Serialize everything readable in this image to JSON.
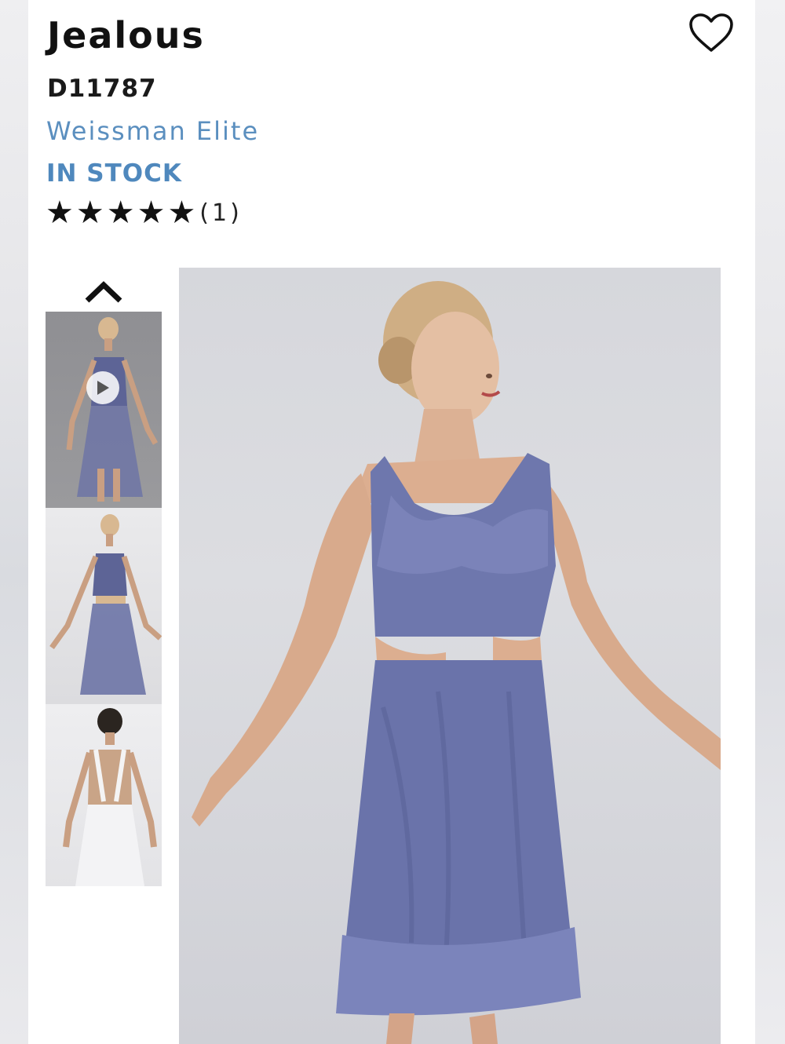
{
  "product": {
    "title": "Jealous",
    "sku": "D11787",
    "brand": "Weissman Elite",
    "stock_status": "IN STOCK",
    "rating": {
      "stars": 5,
      "review_count": "(1)"
    }
  },
  "icons": {
    "wishlist": "heart-outline-icon",
    "scroll_up": "chevron-up-icon",
    "video": "play-icon"
  },
  "gallery": {
    "thumbnails": [
      {
        "kind": "video"
      },
      {
        "kind": "image"
      },
      {
        "kind": "image"
      }
    ]
  },
  "colors": {
    "brand": "#5b8fbf",
    "stock": "#4f88bd",
    "dress": "#6b73a8"
  }
}
